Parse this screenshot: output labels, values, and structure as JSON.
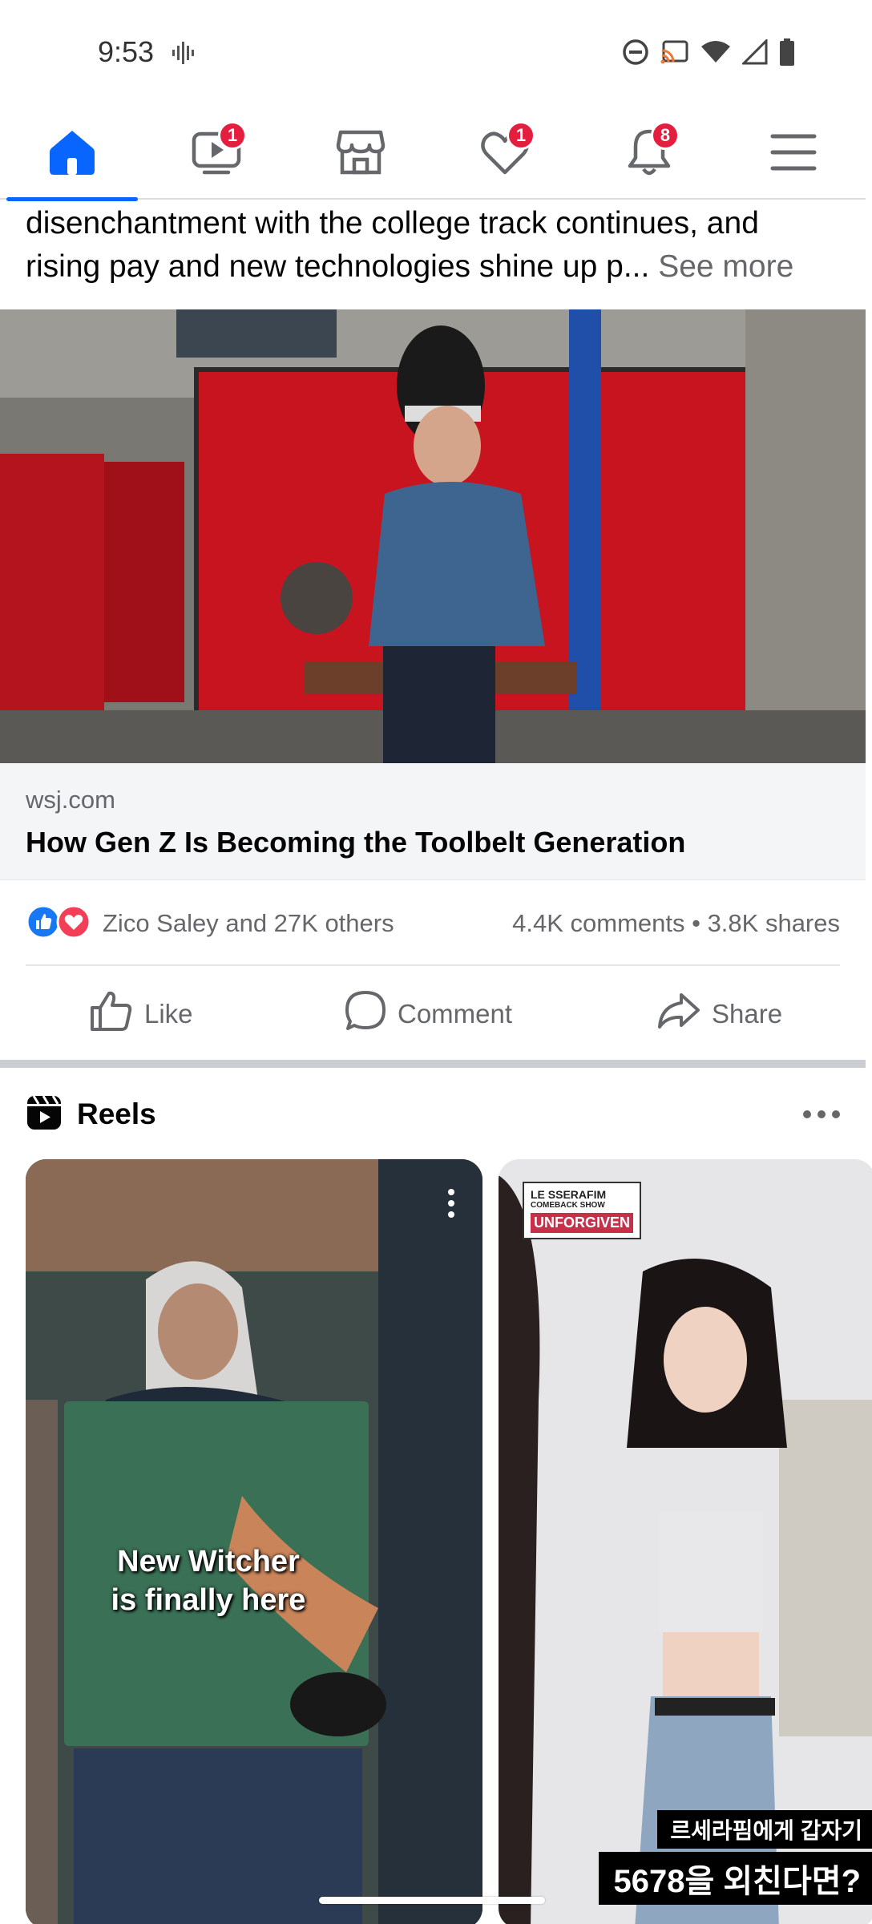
{
  "status_bar": {
    "time": "9:53",
    "icons": [
      "vibrate-icon",
      "dnd-icon",
      "cast-icon",
      "wifi-icon",
      "signal-icon",
      "battery-icon"
    ]
  },
  "nav": {
    "items": [
      {
        "name": "home",
        "icon": "home-icon",
        "active": true
      },
      {
        "name": "video",
        "icon": "video-icon",
        "badge": "1"
      },
      {
        "name": "marketplace",
        "icon": "marketplace-icon"
      },
      {
        "name": "dating",
        "icon": "heart-icon",
        "badge": "1"
      },
      {
        "name": "notifications",
        "icon": "bell-icon",
        "badge": "8"
      },
      {
        "name": "menu",
        "icon": "menu-icon"
      }
    ],
    "accent_color": "#0866ff",
    "badge_color": "#e41e3f"
  },
  "post": {
    "text_line_1": "disenchantment with the college track continues, and",
    "text_line_2": "rising pay and new technologies shine up p...",
    "see_more": "See more",
    "image_alt": "welding-photo",
    "link_domain": "wsj.com",
    "link_title": "How Gen Z Is Becoming the Toolbelt Generation",
    "reactions": {
      "names": "Zico Saley and 27K others",
      "counts": "4.4K comments • 3.8K shares",
      "icons": [
        "like-reaction-icon",
        "love-reaction-icon"
      ]
    },
    "actions": {
      "like": "Like",
      "comment": "Comment",
      "share": "Share"
    }
  },
  "reels": {
    "title": "Reels",
    "items": [
      {
        "caption_line_1": "New Witcher",
        "caption_line_2": "is finally here"
      },
      {
        "brand_line_1": "LE SSERAFIM",
        "brand_line_2": "COMEBACK SHOW",
        "brand_line_3": "UNFORGIVEN",
        "kr_line_1": "르세라핌에게 갑자기",
        "kr_line_2": "5678을 외친다면?"
      }
    ]
  }
}
